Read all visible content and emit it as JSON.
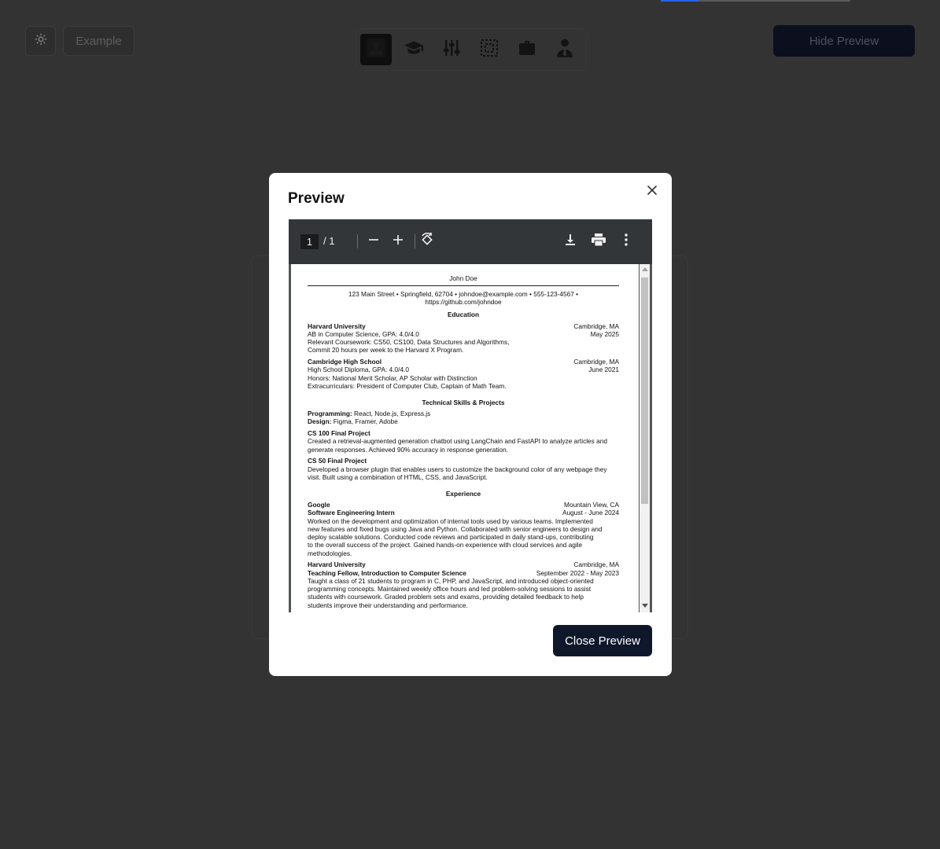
{
  "header": {
    "example_label": "Example",
    "hide_preview_label": "Hide Preview",
    "nav": [
      {
        "name": "personal-info",
        "icon": "person-icon"
      },
      {
        "name": "education",
        "icon": "graduation-cap-icon"
      },
      {
        "name": "skills",
        "icon": "sliders-icon"
      },
      {
        "name": "projects",
        "icon": "dashed-frame-icon"
      },
      {
        "name": "experience",
        "icon": "briefcase-icon"
      },
      {
        "name": "leadership",
        "icon": "businessperson-icon"
      }
    ]
  },
  "modal": {
    "title": "Preview",
    "close_button_label": "Close Preview",
    "viewer": {
      "current_page": "1",
      "total_pages": "/ 1"
    }
  },
  "resume": {
    "name": "John Doe",
    "contact_line1": "123 Main Street • Springfield, 62704 • johndoe@example.com • 555-123-4567 •",
    "contact_line2": "https://github.com/johndoe",
    "education_heading": "Education",
    "edu": [
      {
        "school": "Harvard University",
        "location": "Cambridge, MA",
        "degree": "AB in Computer Science, GPA: 4.0/4.0",
        "date": "May 2025",
        "line3": "Relevant Coursework: CS50, CS100, Data Structures and Algorithms,",
        "line4": "Commit 20 hours per week to the Harvard X Program."
      },
      {
        "school": "Cambridge High School",
        "location": "Cambridge, MA",
        "degree": "High School Diploma, GPA: 4.0/4.0",
        "date": "June 2021",
        "line3": "Honors: National Merit Scholar, AP Scholar with Distinction",
        "line4": "Extracurriculars: President of Computer Club, Captain of Math Team."
      }
    ],
    "skills_heading": "Technical Skills & Projects",
    "skills": [
      {
        "label": "Programming:",
        "value": " React, Node.js, Express.js"
      },
      {
        "label": "Design:",
        "value": " Figma, Framer, Adobe"
      }
    ],
    "projects": [
      {
        "title": "CS 100 Final Project",
        "line1": "Created a retrieval-augmented generation chatbot using LangChain and FastAPI to analyze articles and",
        "line2": "generate responses. Achieved 90% accuracy in response generation."
      },
      {
        "title": "CS 50 Final Project",
        "line1": "Developed a browser plugin that enables users to customize the background color of any webpage they",
        "line2": "visit. Built using a combination of HTML, CSS, and JavaScript."
      }
    ],
    "experience_heading": "Experience",
    "experience": [
      {
        "company": "Google",
        "location": "Mountain View, CA",
        "role": "Software Engineering Intern",
        "date": "August - June 2024",
        "lines": [
          "Worked on the development and optimization of internal tools used by various teams. Implemented",
          "new features and fixed bugs using Java and Python. Collaborated with senior engineers to design and",
          "deploy scalable solutions. Conducted code reviews and participated in daily stand-ups, contributing",
          "to the overall success of the project. Gained hands-on experience with cloud services and agile",
          "methodologies."
        ]
      },
      {
        "company": "Harvard University",
        "location": "Cambridge, MA",
        "role": "Teaching Fellow, Introduction to Computer Science",
        "date": "September 2022 - May 2023",
        "lines": [
          "Taught a class of 21 students to program in C, PHP, and JavaScript, and introduced object-oriented",
          "programming concepts. Maintained weekly office hours and led problem-solving sessions to assist",
          "students with coursework. Graded problem sets and exams, providing detailed feedback to help",
          "students improve their understanding and performance."
        ]
      }
    ]
  },
  "colors": {
    "background": "#333333",
    "primary_button": "#0f172a",
    "progress_accent": "#2563eb"
  }
}
